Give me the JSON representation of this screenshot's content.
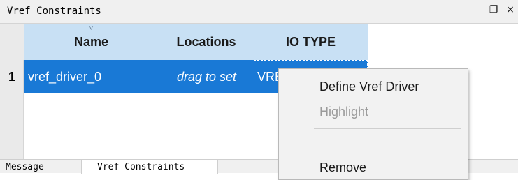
{
  "panel": {
    "title": "Vref Constraints",
    "actions": {
      "float_icon": "float-window-icon",
      "float_glyph": "❐",
      "close_icon": "close-icon",
      "close_glyph": "×"
    }
  },
  "table": {
    "columns": [
      "Name",
      "Locations",
      "IO TYPE"
    ],
    "sort_caret": "˅",
    "rows": [
      {
        "number": "1",
        "name": "vref_driver_0",
        "locations": "drag to set",
        "io_type": "VRE"
      }
    ]
  },
  "context_menu": {
    "items": [
      {
        "label": "Define Vref Driver",
        "enabled": true
      },
      {
        "label": "Highlight",
        "enabled": false
      },
      {
        "label": "Remove",
        "enabled": true
      }
    ]
  },
  "tabs": [
    {
      "label": "Message",
      "active": false
    },
    {
      "label": "Vref Constraints",
      "active": true
    }
  ],
  "colors": {
    "header_bg": "#c8e0f4",
    "selected_row": "#1979d6",
    "panel_bg": "#f0f0f0"
  }
}
